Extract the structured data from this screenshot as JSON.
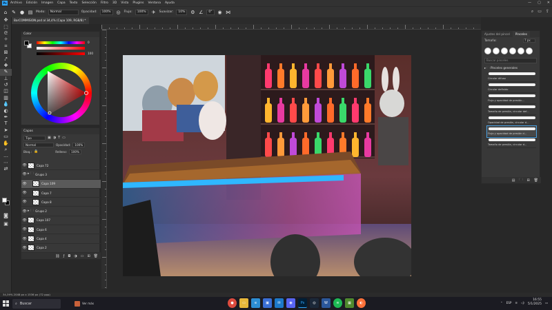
{
  "app": {
    "logo": "Ps",
    "menu": [
      "Archivo",
      "Edición",
      "Imagen",
      "Capa",
      "Texto",
      "Selección",
      "Filtro",
      "3D",
      "Vista",
      "Plugins",
      "Ventana",
      "Ayuda"
    ],
    "window_controls": [
      "—",
      "▢",
      "✕"
    ]
  },
  "options": {
    "mode_label": "Modo:",
    "mode_value": "Normal",
    "opacity_label": "Opacidad:",
    "opacity_value": "100%",
    "flow_label": "Flujo:",
    "flow_value": "100%",
    "smoothing_label": "Suavizar:",
    "smoothing_value": "10%",
    "angle_value": "0°"
  },
  "document": {
    "tab_title": "BarCOMMISION.psd al 34,4% (Capa 109, RGB/8) *"
  },
  "color_panel": {
    "tab": "Color",
    "value_top": "0",
    "value_bottom": "100"
  },
  "layers_panel": {
    "tab": "Capas",
    "filter_label": "Tipo",
    "blend_mode": "Normal",
    "opacity_label": "Opacidad:",
    "opacity_value": "100%",
    "lock_label": "Bloq.:",
    "fill_label": "Relleno:",
    "fill_value": "100%",
    "layers": [
      {
        "name": "Capa 72",
        "type": "layer",
        "indent": 0,
        "selected": false
      },
      {
        "name": "Grupo 3",
        "type": "group",
        "indent": 0,
        "selected": false
      },
      {
        "name": "Capa 109",
        "type": "layer",
        "indent": 1,
        "selected": true
      },
      {
        "name": "Capa 7",
        "type": "layer",
        "indent": 1,
        "selected": false
      },
      {
        "name": "Capa 8",
        "type": "layer",
        "indent": 1,
        "selected": false
      },
      {
        "name": "Grupo 2",
        "type": "group",
        "indent": 0,
        "selected": false
      },
      {
        "name": "Capa 107",
        "type": "layer",
        "indent": 0,
        "selected": false
      },
      {
        "name": "Capa 6",
        "type": "layer",
        "indent": 0,
        "selected": false
      },
      {
        "name": "Capa 4",
        "type": "layer",
        "indent": 0,
        "selected": false
      },
      {
        "name": "Capa 2",
        "type": "layer",
        "indent": 0,
        "selected": false
      }
    ]
  },
  "brushes_panel": {
    "tab_settings": "Ajustes del pincel",
    "tab_brushes": "Pinceles",
    "size_label": "Tamaño:",
    "size_value": "7 px",
    "search_placeholder": "Buscar pinceles",
    "group_name": "Pinceles generales",
    "brushes": [
      {
        "name": "Circular difuso",
        "selected": false
      },
      {
        "name": "Circular definido",
        "selected": false
      },
      {
        "name": "Flujo y opacidad de presión...",
        "selected": false
      },
      {
        "name": "Tamaño de presión, circular def...",
        "selected": false
      },
      {
        "name": "Opacidad de presión, circular d...",
        "selected": false
      },
      {
        "name": "Flujo y opacidad de presión d...",
        "selected": true
      },
      {
        "name": "Tamaño de presión, circular d...",
        "selected": false
      }
    ]
  },
  "status": {
    "text": "34,39%     2048 px x 1536 px (72 ppp)"
  },
  "taskbar": {
    "search_label": "Buscar",
    "widget_text": "Ver más",
    "language": "ESP",
    "time": "16:55",
    "date": "5/1/2025"
  },
  "colors": {
    "accent": "#31a8ff",
    "panel_bg": "#383838",
    "app_bg": "#282828"
  }
}
